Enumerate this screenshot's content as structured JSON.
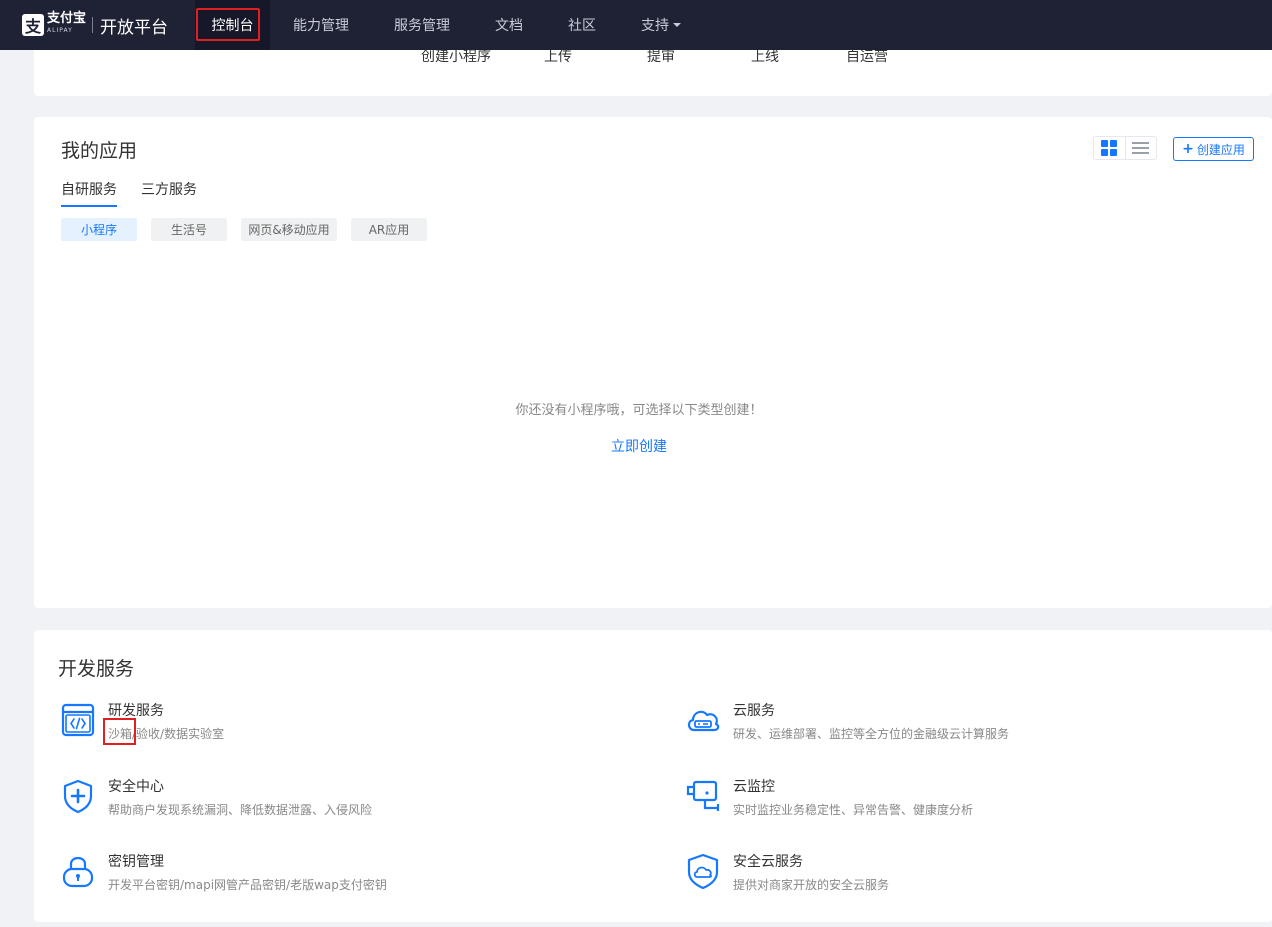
{
  "nav": {
    "brand_cn": "支付宝",
    "brand_en": "ALIPAY",
    "brand_title": "开放平台",
    "items": [
      {
        "label": "控制台"
      },
      {
        "label": "能力管理"
      },
      {
        "label": "服务管理"
      },
      {
        "label": "文档"
      },
      {
        "label": "社区"
      },
      {
        "label": "支持"
      }
    ]
  },
  "steps": [
    "创建小程序",
    "上传",
    "提审",
    "上线",
    "自运营"
  ],
  "apps": {
    "title": "我的应用",
    "create_label": "创建应用",
    "tabs": [
      "自研服务",
      "三方服务"
    ],
    "filters": [
      "小程序",
      "生活号",
      "网页&移动应用",
      "AR应用"
    ],
    "empty_text": "你还没有小程序哦，可选择以下类型创建！",
    "empty_link": "立即创建"
  },
  "dev": {
    "title": "开发服务",
    "services": [
      {
        "title": "研发服务",
        "desc": "沙箱/验收/数据实验室",
        "icon": "code-window-icon"
      },
      {
        "title": "云服务",
        "desc": "研发、运维部署、监控等全方位的金融级云计算服务",
        "icon": "cloud-server-icon"
      },
      {
        "title": "安全中心",
        "desc": "帮助商户发现系统漏洞、降低数据泄露、入侵风险",
        "icon": "shield-plus-icon"
      },
      {
        "title": "云监控",
        "desc": "实时监控业务稳定性、异常告警、健康度分析",
        "icon": "camera-monitor-icon"
      },
      {
        "title": "密钥管理",
        "desc": "开发平台密钥/mapi网管产品密钥/老版wap支付密钥",
        "icon": "lock-icon"
      },
      {
        "title": "安全云服务",
        "desc": "提供对商家开放的安全云服务",
        "icon": "shield-cloud-icon"
      }
    ]
  },
  "colors": {
    "accent": "#1677ff",
    "nav_bg": "#1f2235",
    "highlight": "#e02020"
  }
}
